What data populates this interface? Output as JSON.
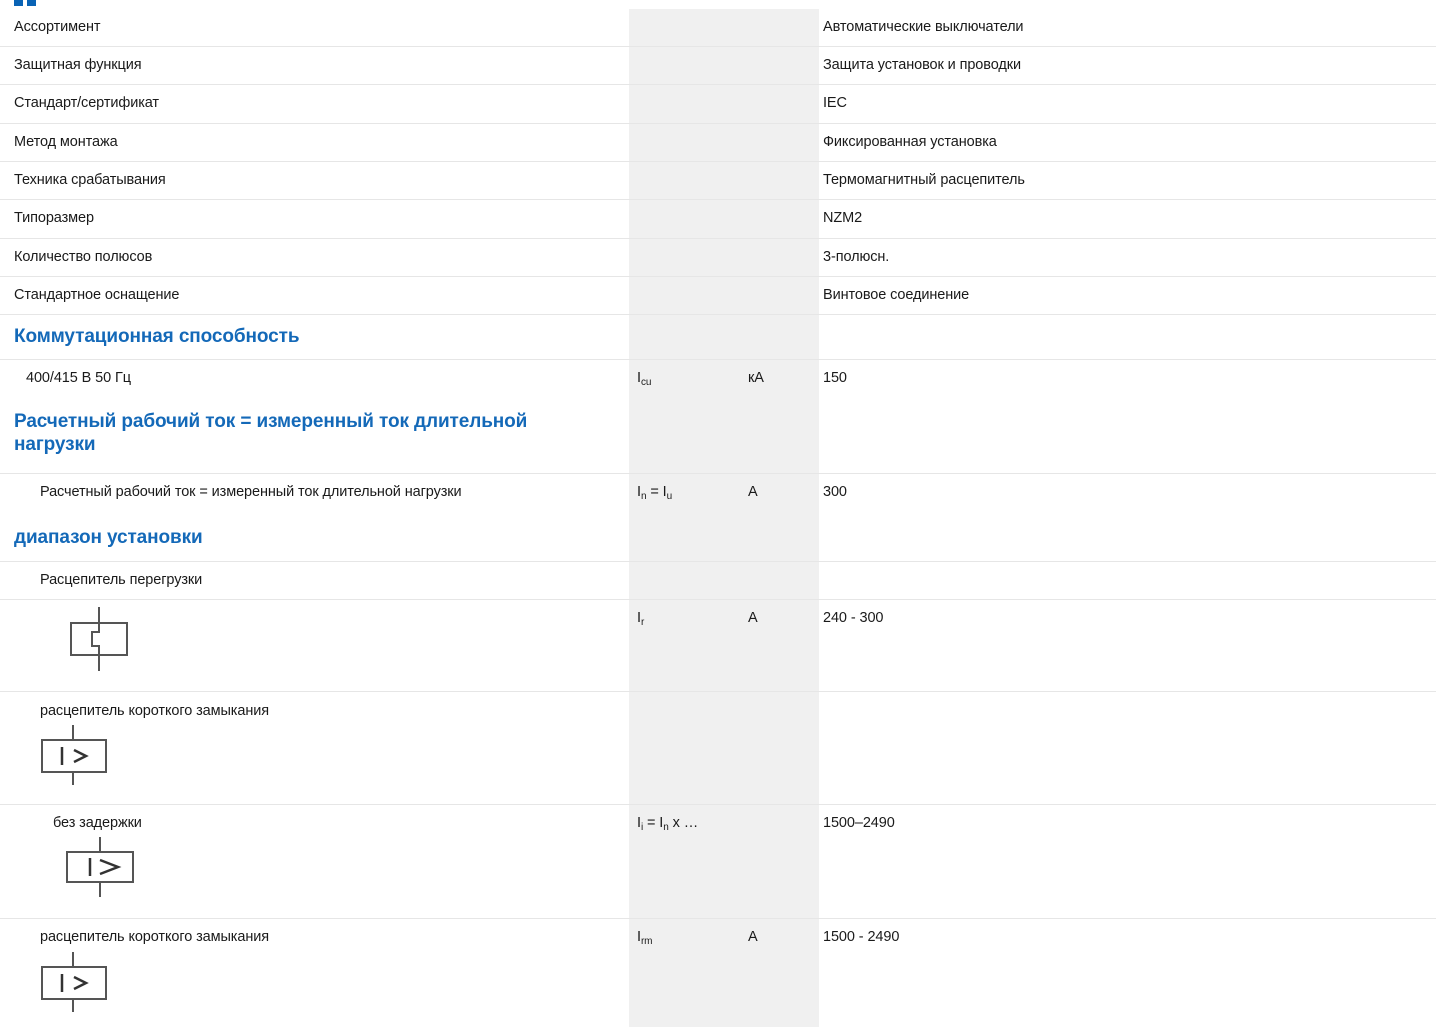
{
  "rows": {
    "assortment": {
      "label": "Ассортимент",
      "value": "Автоматические выключатели"
    },
    "protective_function": {
      "label": "Защитная функция",
      "value": "Защита установок и проводки"
    },
    "standard": {
      "label": "Стандарт/сертификат",
      "value": "IEC"
    },
    "mounting": {
      "label": "Метод монтажа",
      "value": "Фиксированная установка"
    },
    "release_tech": {
      "label": "Техника срабатывания",
      "value": "Термомагнитный расцепитель"
    },
    "frame_size": {
      "label": "Типоразмер",
      "value": "NZM2"
    },
    "poles": {
      "label": "Количество полюсов",
      "value": "3-полюсн."
    },
    "standard_equipment": {
      "label": "Стандартное оснащение",
      "value": "Винтовое соединение"
    }
  },
  "breaking_capacity": {
    "heading": "Коммутационная способность",
    "row": {
      "label": "400/415 В 50 Гц",
      "sym_main": "I",
      "sym_sub": "cu",
      "unit": "кА",
      "value": "150"
    }
  },
  "rated_current": {
    "heading_line1": "Расчетный рабочий ток = измеренный ток длительной",
    "heading_line2": "нагрузки",
    "row": {
      "label": "Расчетный рабочий ток = измеренный ток длительной нагрузки",
      "sym_a": "I",
      "sym_a_sub": "n",
      "sym_eq": " = ",
      "sym_b": "I",
      "sym_b_sub": "u",
      "unit": "A",
      "value": "300"
    }
  },
  "setting_range": {
    "heading": "диапазон установки",
    "overload": {
      "label": "Расцепитель перегрузки"
    },
    "overload_row": {
      "sym_main": "I",
      "sym_sub": "r",
      "unit": "A",
      "value": "240 - 300",
      "icon": "thermal-release-icon"
    },
    "short_circuit_a": {
      "label": "расцепитель короткого замыкания",
      "icon": "instantaneous-release-icon"
    },
    "no_delay": {
      "label": "без задержки",
      "sym_a": "I",
      "sym_a_sub": "i",
      "sym_eq": " = ",
      "sym_b": "I",
      "sym_b_sub": "n",
      "sym_tail": " x …",
      "value": "1500–2490",
      "icon": "instantaneous-release-icon"
    },
    "short_circuit_b": {
      "label": "расцепитель короткого замыкания",
      "sym_main": "I",
      "sym_sub": "rm",
      "unit": "A",
      "value": "1500 - 2490",
      "icon": "instantaneous-release-icon"
    }
  },
  "colors": {
    "heading": "#1469b8",
    "band": "#f0f0f0",
    "separator": "#e6e6e6"
  }
}
